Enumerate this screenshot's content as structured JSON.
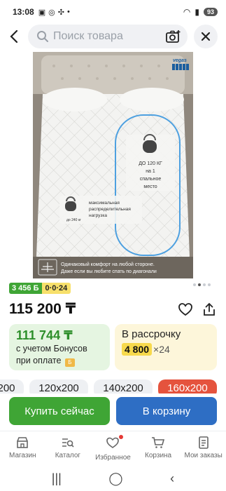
{
  "status": {
    "time": "13:08",
    "battery": "93"
  },
  "search": {
    "placeholder": "Поиск товара"
  },
  "photo": {
    "brand_logo": "vegas",
    "zone_label_1": "ДО 120 КГ",
    "zone_label_2": "на 1",
    "zone_label_3": "спальное",
    "zone_label_4": "место",
    "center_label_1": "максимальная",
    "center_label_2": "распределительная",
    "center_label_3": "нагрузка",
    "weight_label": "до 240 кг",
    "bottom_text_1": "Одинаковый комфорт на любой стороне.",
    "bottom_text_2": "Даже если вы любите спать по диагонали"
  },
  "badges": {
    "bonus": "3 456 Б",
    "installment_badge": "0·0·24"
  },
  "price": "115 200 ₸",
  "bonus_card": {
    "amount": "111 744 ₸",
    "line1": "с учетом Бонусов",
    "line2": "при оплате"
  },
  "installment_card": {
    "title": "В рассрочку",
    "amount": "4 800",
    "months": "×24"
  },
  "sizes": [
    {
      "label": "200",
      "selected": false
    },
    {
      "label": "120х200",
      "selected": false
    },
    {
      "label": "140х200",
      "selected": false
    },
    {
      "label": "160х200",
      "selected": true
    }
  ],
  "actions": {
    "buy_now": "Купить сейчас",
    "to_cart": "В корзину"
  },
  "nav": [
    {
      "label": "Магазин",
      "icon": "shop-icon"
    },
    {
      "label": "Каталог",
      "icon": "catalog-icon"
    },
    {
      "label": "Избранное",
      "icon": "heart-icon"
    },
    {
      "label": "Корзина",
      "icon": "cart-icon"
    },
    {
      "label": "Мои заказы",
      "icon": "orders-icon"
    }
  ],
  "colors": {
    "green": "#3fa535",
    "blue": "#2e6ec4",
    "red": "#e5533d",
    "bonus_bg": "#e5f5e1",
    "installment_bg": "#fdf6da"
  }
}
